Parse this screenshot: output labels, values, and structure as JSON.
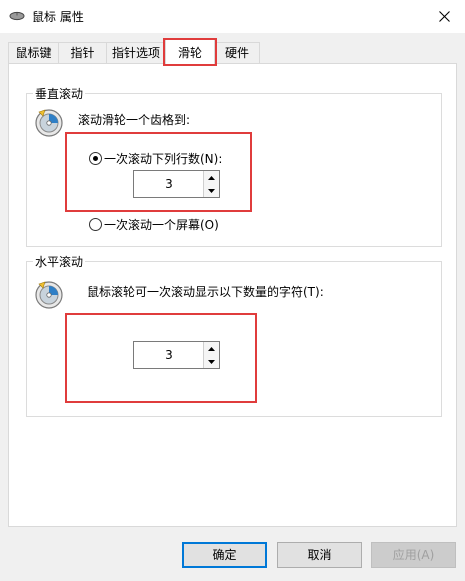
{
  "window": {
    "title": "鼠标 属性",
    "icon": "mouse-icon",
    "close_icon": "close-icon"
  },
  "tabs": [
    {
      "label": "鼠标键",
      "active": false
    },
    {
      "label": "指针",
      "active": false
    },
    {
      "label": "指针选项",
      "active": false
    },
    {
      "label": "滑轮",
      "active": true
    },
    {
      "label": "硬件",
      "active": false
    }
  ],
  "vertical": {
    "group_title": "垂直滚动",
    "instruction": "滚动滑轮一个齿格到:",
    "option_lines_label": "一次滚动下列行数(N):",
    "option_lines_selected": true,
    "lines_value": "3",
    "option_screen_label": "一次滚动一个屏幕(O)",
    "option_screen_selected": false
  },
  "horizontal": {
    "group_title": "水平滚动",
    "instruction": "鼠标滚轮可一次滚动显示以下数量的字符(T):",
    "chars_value": "3"
  },
  "buttons": {
    "ok": "确定",
    "cancel": "取消",
    "apply": "应用(A)"
  },
  "colors": {
    "highlight": "#e03c3c",
    "default_button_border": "#0078d7"
  }
}
